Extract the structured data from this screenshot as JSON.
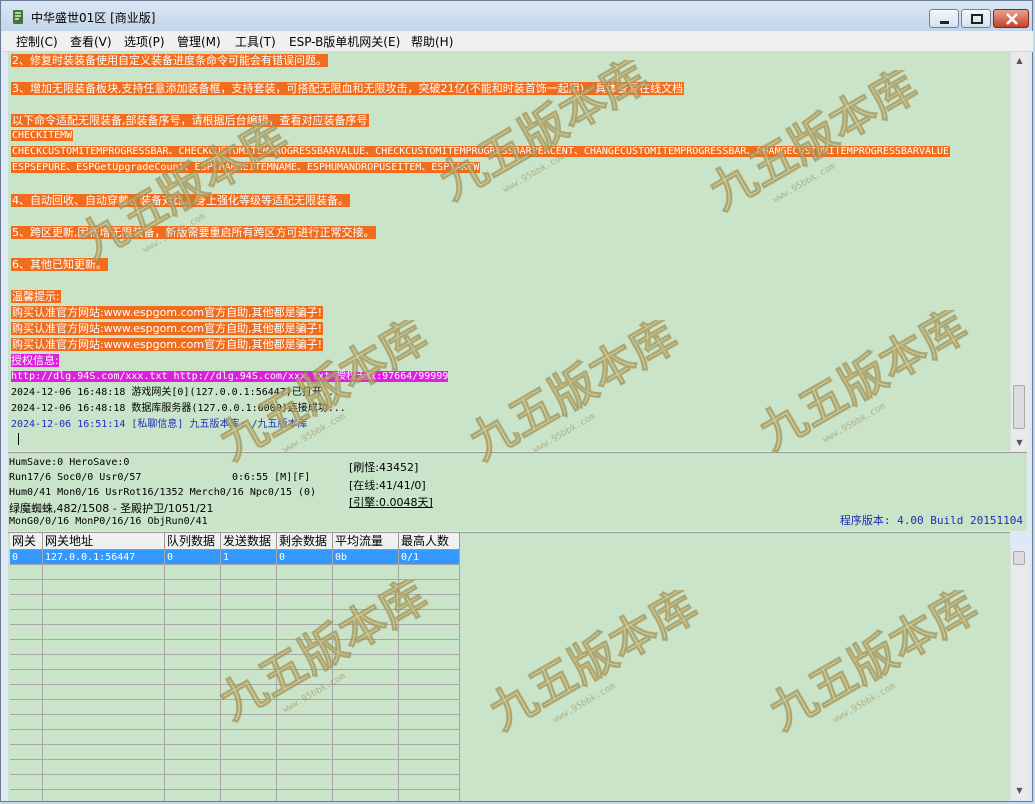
{
  "window": {
    "title": "中华盛世01区 [商业版]"
  },
  "menu": [
    "控制(C)",
    "查看(V)",
    "选项(P)",
    "管理(M)",
    "工具(T)",
    "ESP-B版单机网关(E)",
    "帮助(H)"
  ],
  "log": {
    "lines": [
      {
        "text": "2、修复时装装备使用自定义装备进度条命令可能会有错误问题。",
        "style": "hl"
      },
      {
        "text": "3、增加无限装备板块,支持任意添加装备框，支持套装，可搭配无限血和无限攻击，突破21亿(不能和时装首饰一起用)，具体查看在线文档",
        "style": "hl"
      },
      {
        "text": "以下命令适配无限装备,部装备序号，请根据后台编辑，查看对应装备序号",
        "style": "hl"
      },
      {
        "text": "CHECKITEMW",
        "style": "hl"
      },
      {
        "text": "CHECKCUSTOMITEMPROGRESSBAR、CHECKCUSTOMITEMPROGRESSBARVALUE、CHECKCUSTOMITEMPROGRESSBARPERCENT、CHANGECUSTOMITEMPROGRESSBAR、CHANGECUSTOMITEMPROGRESSBARVALUE",
        "style": "hl"
      },
      {
        "text": "ESPSEPURE、ESPGetUpgradeCount、ESPCHANGEITEMNAME、ESPHUMANDROPUSEITEM、ESPTAKEW",
        "style": "hl"
      },
      {
        "text": "4、自动回收、自动穿戴、装备对比、身上强化等级等适配无限装备。",
        "style": "hl"
      },
      {
        "text": "5、跨区更新,因新增无限装备，新版需要重启所有跨区方可进行正常交接。",
        "style": "hl"
      },
      {
        "text": "6、其他已知更新。",
        "style": "hl"
      },
      {
        "text": "温馨提示:",
        "style": "hl"
      },
      {
        "text": "购买认准官方网站:www.espgom.com官方自助,其他都是骗子!",
        "style": "hl"
      },
      {
        "text": "购买认准官方网站:www.espgom.com官方自助,其他都是骗子!",
        "style": "hl"
      },
      {
        "text": "购买认准官方网站:www.espgom.com官方自助,其他都是骗子!",
        "style": "hl"
      },
      {
        "text": "授权信息:",
        "style": "mag"
      },
      {
        "text": "http://dlg.94S.com/xxx.txt http://dlg.94S.com/xxx.txt 授权天数:97664/99999",
        "style": "mag"
      },
      {
        "text": "2024-12-06 16:48:18 游戏网关[0](127.0.0.1:56447)已打开...",
        "style": "plain"
      },
      {
        "text": "2024-12-06 16:48:18 数据库服务器(127.0.0.1:6000)连接成功...",
        "style": "plain"
      },
      {
        "text": "2024-12-06 16:51:14 [私聊信息] 九五版本库: /九五版本库",
        "style": "blue"
      }
    ]
  },
  "status": {
    "humsave": "HumSave:0 HeroSave:0",
    "run": "Run17/6 Soc0/0 Usr0/57",
    "time": "0:6:55 [M][F]",
    "hum": "Hum0/41 Mon0/16 UsrRot16/1352 Merch0/16 Npc0/15 (0)",
    "monster": "绿魔蜘蛛,482/1508 - 圣殿护卫/1051/21",
    "mong": "MonG0/0/16 MonP0/16/16 ObjRun0/41",
    "refresh": "[刷怪:43452]",
    "online": "[在线:41/41/0]",
    "engine": "[引擎:0.0048天]",
    "version": "程序版本: 4.00 Build 20151104"
  },
  "grid": {
    "headers": [
      "网关",
      "网关地址",
      "队列数据",
      "发送数据",
      "剩余数据",
      "平均流量",
      "最高人数"
    ],
    "rows": [
      [
        "0",
        "127.0.0.1:56447",
        "0",
        "1",
        "0",
        "0b",
        "0/1"
      ]
    ]
  },
  "watermark": {
    "text": "九五版本库",
    "url": "www.95bbk.com"
  }
}
